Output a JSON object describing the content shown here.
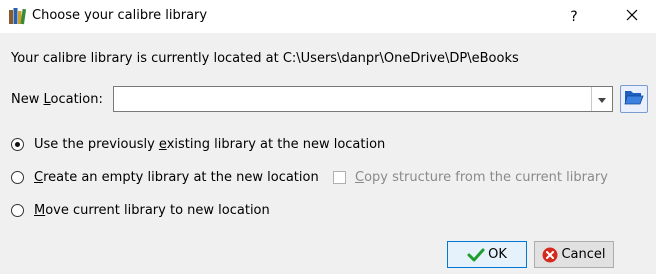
{
  "window": {
    "title": "Choose your calibre library",
    "help_label": "?"
  },
  "location_text": "Your calibre library is currently located at C:\\Users\\danpr\\OneDrive\\DP\\eBooks",
  "new_location": {
    "label_prefix": "New ",
    "label_mnemonic": "L",
    "label_suffix": "ocation:",
    "value": ""
  },
  "options": [
    {
      "prefix": "Use the previously ",
      "mnemonic": "e",
      "suffix": "xisting library at the new location",
      "checked": true
    },
    {
      "prefix": "",
      "mnemonic": "C",
      "suffix": "reate an empty library at the new location",
      "checked": false
    },
    {
      "prefix": "",
      "mnemonic": "M",
      "suffix": "ove current library to new location",
      "checked": false
    }
  ],
  "copy_structure": {
    "prefix": "",
    "mnemonic": "C",
    "suffix": "opy structure from the current library",
    "checked": false,
    "enabled": false
  },
  "buttons": {
    "ok_label": "OK",
    "cancel_label": "Cancel"
  },
  "icons": {
    "app": "calibre-books-icon",
    "close": "close-icon",
    "dropdown": "chevron-down-icon",
    "browse": "folder-open-icon",
    "ok": "checkmark-icon",
    "cancel": "cancel-icon"
  },
  "colors": {
    "accent": "#0078d7",
    "ok_check": "#1e9e2e",
    "cancel_red": "#d42b1e",
    "folder_blue": "#1f5fbf"
  }
}
